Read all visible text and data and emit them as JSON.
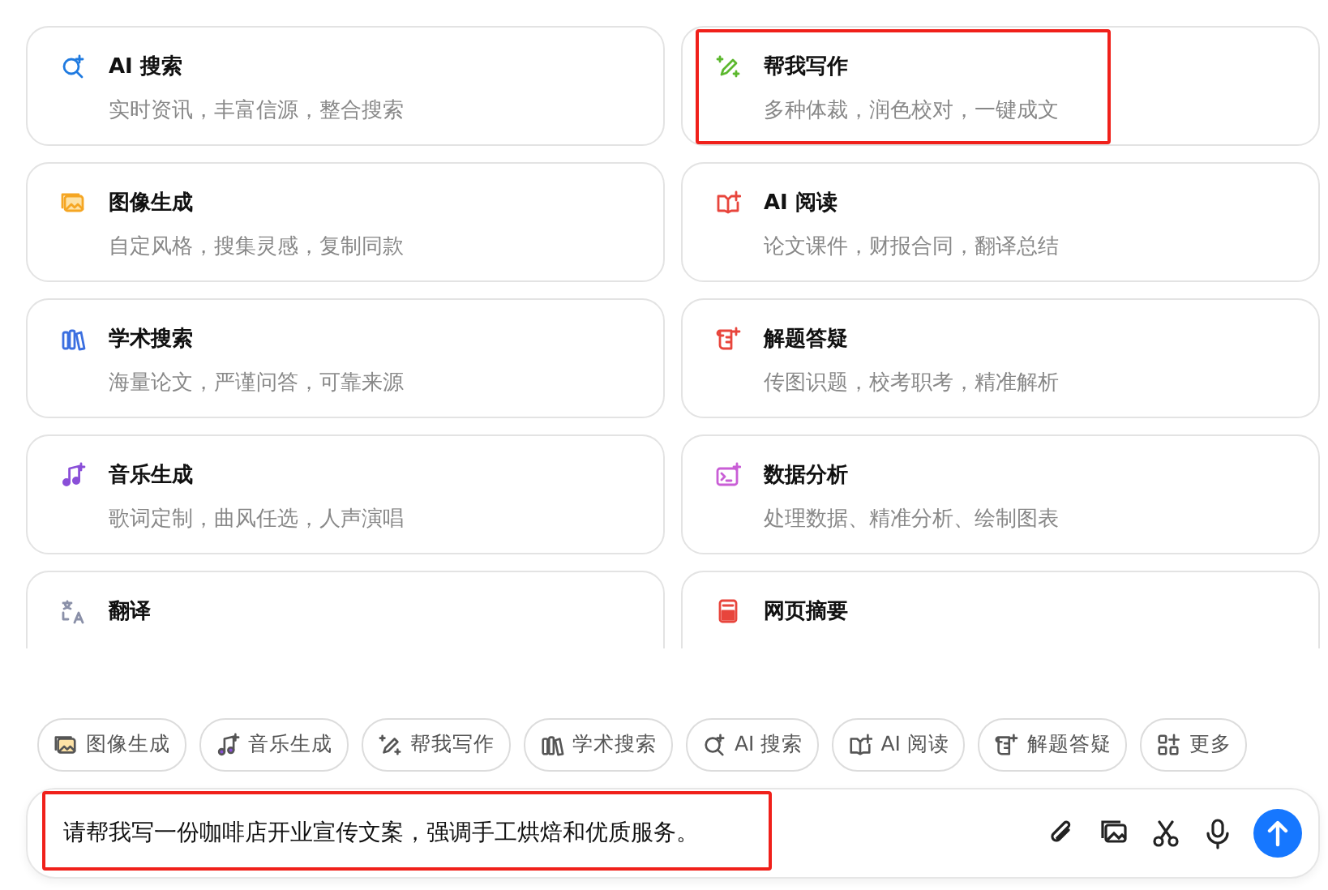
{
  "cards": [
    {
      "title": "AI 搜索",
      "subtitle": "实时资讯，丰富信源，整合搜索",
      "highlighted": false
    },
    {
      "title": "帮我写作",
      "subtitle": "多种体裁，润色校对，一键成文",
      "highlighted": true
    },
    {
      "title": "图像生成",
      "subtitle": "自定风格，搜集灵感，复制同款",
      "highlighted": false
    },
    {
      "title": "AI 阅读",
      "subtitle": "论文课件，财报合同，翻译总结",
      "highlighted": false
    },
    {
      "title": "学术搜索",
      "subtitle": "海量论文，严谨问答，可靠来源",
      "highlighted": false
    },
    {
      "title": "解题答疑",
      "subtitle": "传图识题，校考职考，精准解析",
      "highlighted": false
    },
    {
      "title": "音乐生成",
      "subtitle": "歌词定制，曲风任选，人声演唱",
      "highlighted": false
    },
    {
      "title": "数据分析",
      "subtitle": "处理数据、精准分析、绘制图表",
      "highlighted": false
    },
    {
      "title": "翻译",
      "highlighted": false
    },
    {
      "title": "网页摘要",
      "highlighted": false
    }
  ],
  "chips": [
    "图像生成",
    "音乐生成",
    "帮我写作",
    "学术搜索",
    "AI 搜索",
    "AI 阅读",
    "解题答疑",
    "更多"
  ],
  "composer": {
    "value": "请帮我写一份咖啡店开业宣传文案，强调手工烘焙和优质服务。",
    "highlighted": true
  }
}
